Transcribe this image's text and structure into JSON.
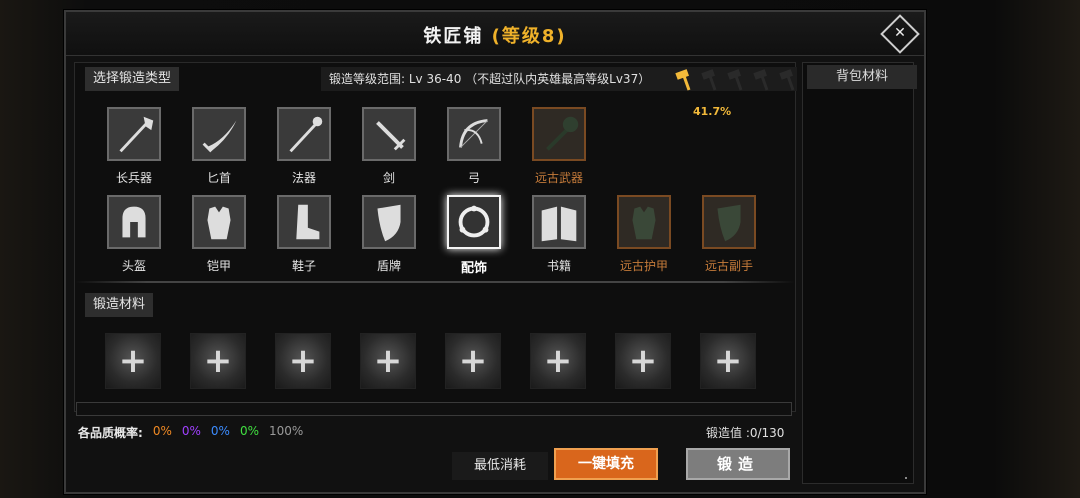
{
  "window": {
    "title_main": "铁匠铺",
    "title_level": "(等级8)"
  },
  "type_section": {
    "tab_label": "选择锻造类型",
    "range_text": "锻造等级范围: Lv 36-40  （不超过队内英雄最高等级Lv37）",
    "progress_percent": "41.7%",
    "hammers_filled": 1,
    "hammers_total": 5,
    "row1": [
      {
        "label": "长兵器",
        "icon": "polearm-icon",
        "ancient": false
      },
      {
        "label": "匕首",
        "icon": "dagger-icon",
        "ancient": false
      },
      {
        "label": "法器",
        "icon": "staff-icon",
        "ancient": false
      },
      {
        "label": "剑",
        "icon": "sword-icon",
        "ancient": false
      },
      {
        "label": "弓",
        "icon": "bow-icon",
        "ancient": false
      },
      {
        "label": "远古武器",
        "icon": "mace-icon",
        "ancient": true
      }
    ],
    "row2": [
      {
        "label": "头盔",
        "icon": "helmet-icon",
        "ancient": false
      },
      {
        "label": "铠甲",
        "icon": "armor-icon",
        "ancient": false
      },
      {
        "label": "鞋子",
        "icon": "boots-icon",
        "ancient": false
      },
      {
        "label": "盾牌",
        "icon": "shield-icon",
        "ancient": false
      },
      {
        "label": "配饰",
        "icon": "ring-icon",
        "ancient": false,
        "selected": true
      },
      {
        "label": "书籍",
        "icon": "book-icon",
        "ancient": false
      },
      {
        "label": "远古护甲",
        "icon": "armor-icon",
        "ancient": true
      },
      {
        "label": "远古副手",
        "icon": "shield-icon",
        "ancient": true
      }
    ]
  },
  "materials": {
    "tab_label": "锻造材料",
    "slot_symbol": "+"
  },
  "quality": {
    "label": "各品质概率:",
    "rates": [
      {
        "value": "0%",
        "color": "#f08a24"
      },
      {
        "value": "0%",
        "color": "#a040ff"
      },
      {
        "value": "0%",
        "color": "#3c8cff"
      },
      {
        "value": "0%",
        "color": "#40e040"
      },
      {
        "value": "100%",
        "color": "#9a9a9a"
      }
    ]
  },
  "forge_value": "锻造值 :0/130",
  "buttons": {
    "min_cost": "最低消耗",
    "auto_fill": "一键填充",
    "forge": "锻造"
  },
  "backpack": {
    "tab_label": "背包材料"
  }
}
